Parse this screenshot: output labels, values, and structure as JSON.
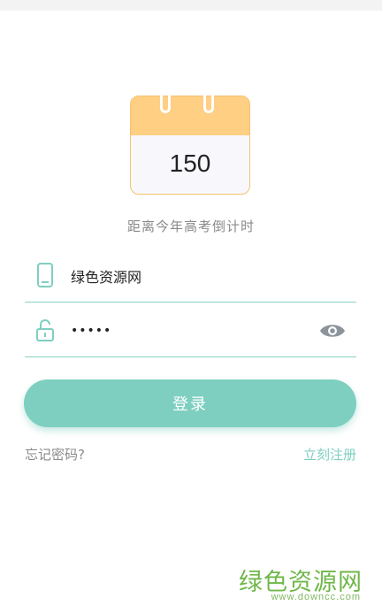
{
  "calendar": {
    "days": "150",
    "label": "距离今年高考倒计时"
  },
  "username": {
    "value": "绿色资源网",
    "icon": "phone-icon"
  },
  "password": {
    "value": "•••••",
    "icon": "unlock-icon",
    "toggle_icon": "eye-icon"
  },
  "login": {
    "label": "登录"
  },
  "links": {
    "forgot": "忘记密码?",
    "register": "立刻注册"
  },
  "watermark": {
    "title": "绿色资源网",
    "url": "www.downcc.com"
  },
  "colors": {
    "accent": "#7ecfc0",
    "calendar_header": "#ffcf83",
    "watermark": "#70b74a"
  }
}
